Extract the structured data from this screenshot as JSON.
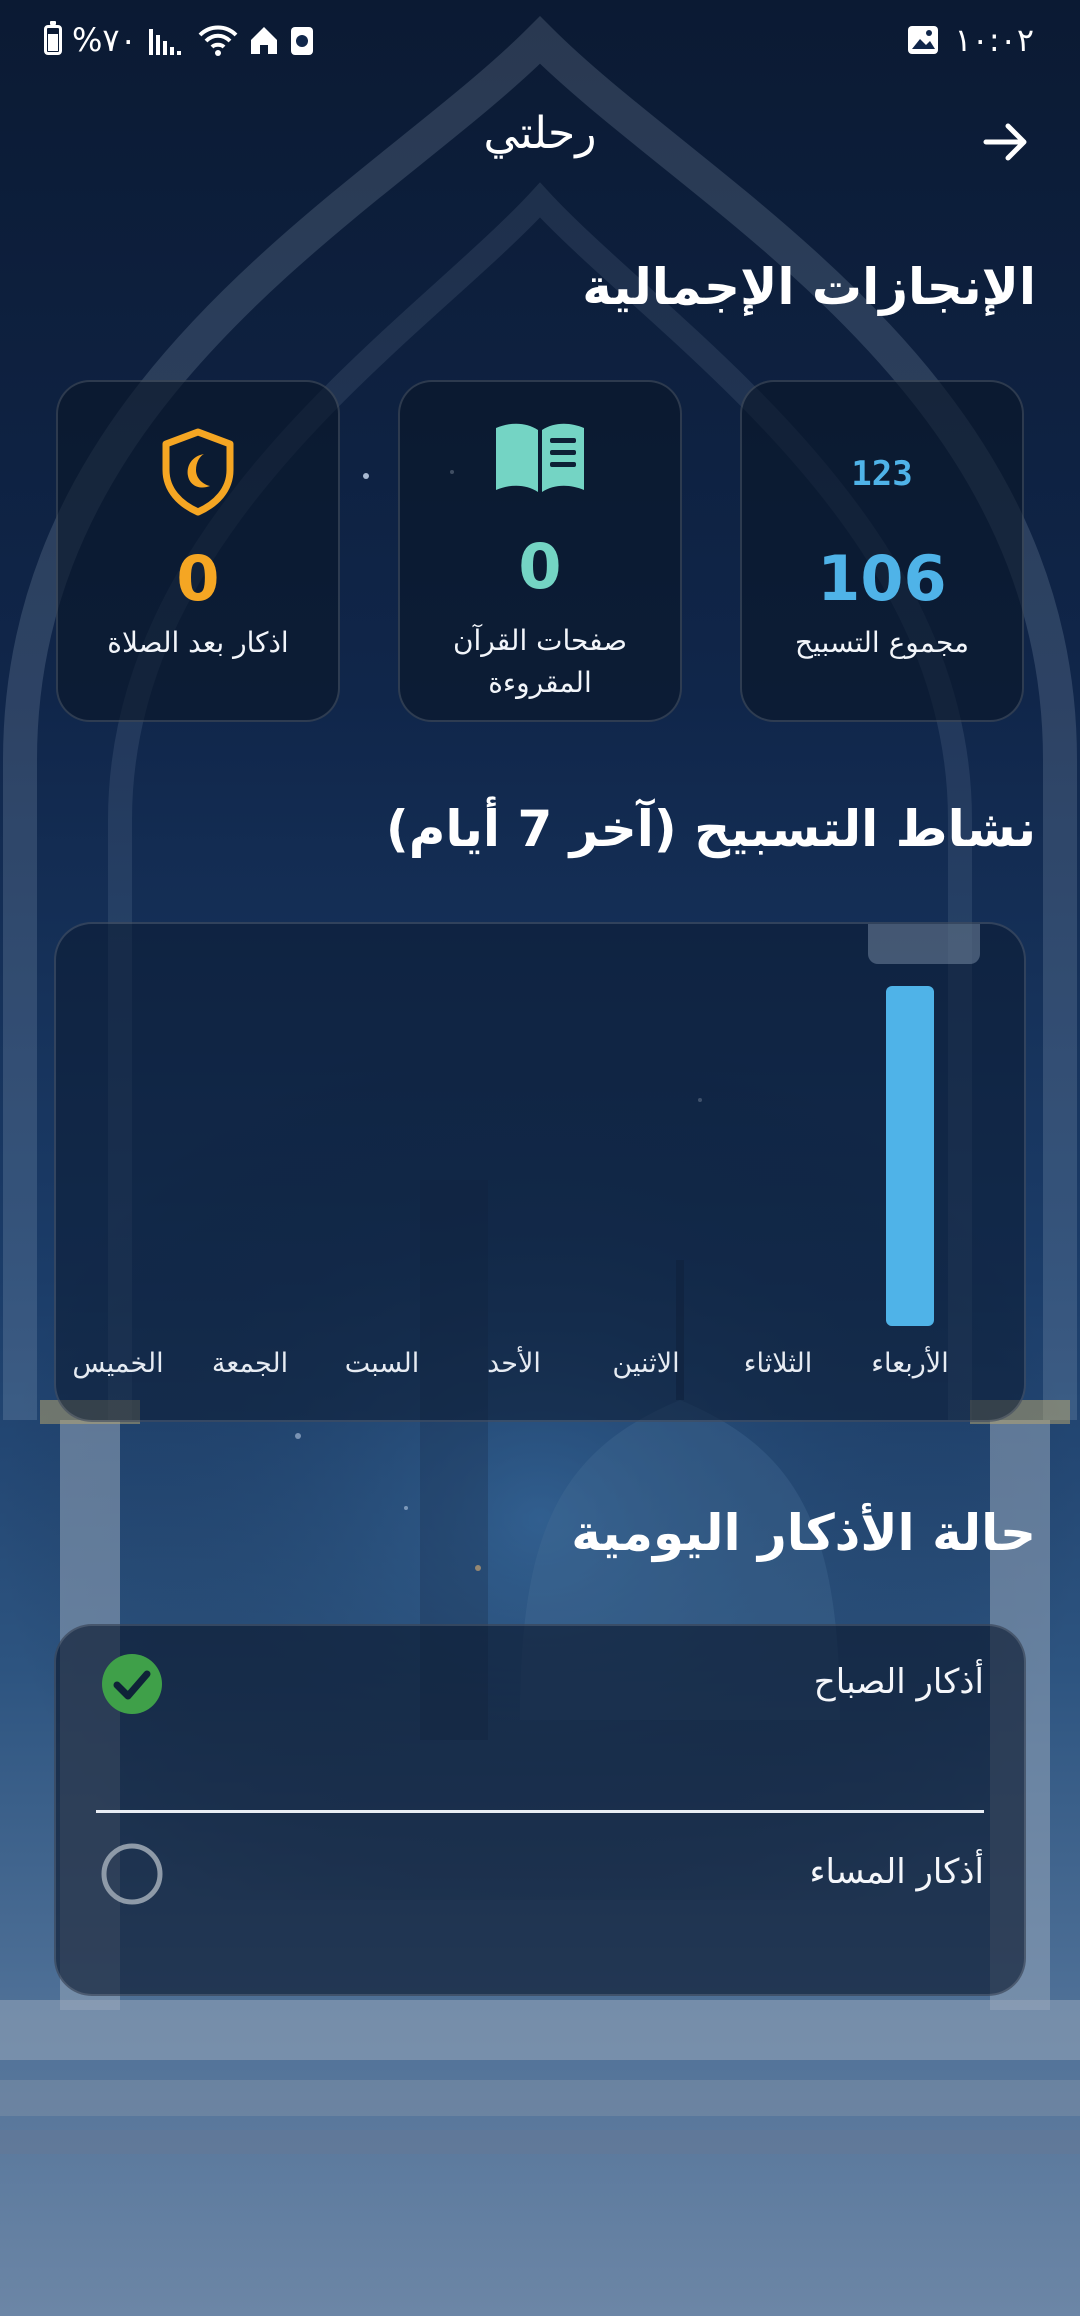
{
  "status_bar": {
    "time": "١٠:٠٢",
    "battery": "%٧٠"
  },
  "app_bar": {
    "title": "رحلتي",
    "back_icon": "arrow-right-icon"
  },
  "achievements": {
    "title": "الإنجازات الإجمالية",
    "cards": [
      {
        "icon": "counter-123-icon",
        "value": "106",
        "label": "مجموع التسبيح",
        "color": "#4fb3e8"
      },
      {
        "icon": "open-book-icon",
        "value": "0",
        "label": "صفحات القرآن المقروءة",
        "color": "#74d4c4"
      },
      {
        "icon": "shield-moon-icon",
        "value": "0",
        "label": "اذكار بعد الصلاة",
        "color": "#f5a623"
      }
    ]
  },
  "activity": {
    "title": "نشاط التسبيح (آخر 7 أيام)"
  },
  "chart_data": {
    "type": "bar",
    "categories": [
      "الأربعاء",
      "الثلاثاء",
      "الاثنين",
      "الأحد",
      "السبت",
      "الجمعة",
      "الخميس"
    ],
    "values": [
      106,
      0,
      0,
      0,
      0,
      0,
      0
    ],
    "ylim": [
      0,
      106
    ],
    "bar_color": "#4fb3e8",
    "grid": false
  },
  "daily_status": {
    "title": "حالة الأذكار اليومية",
    "items": [
      {
        "label": "أذكار الصباح",
        "done": true
      },
      {
        "label": "أذكار المساء",
        "done": false
      }
    ]
  },
  "colors": {
    "check_done": "#3fa049",
    "check_pending": "#8e9aa8"
  }
}
